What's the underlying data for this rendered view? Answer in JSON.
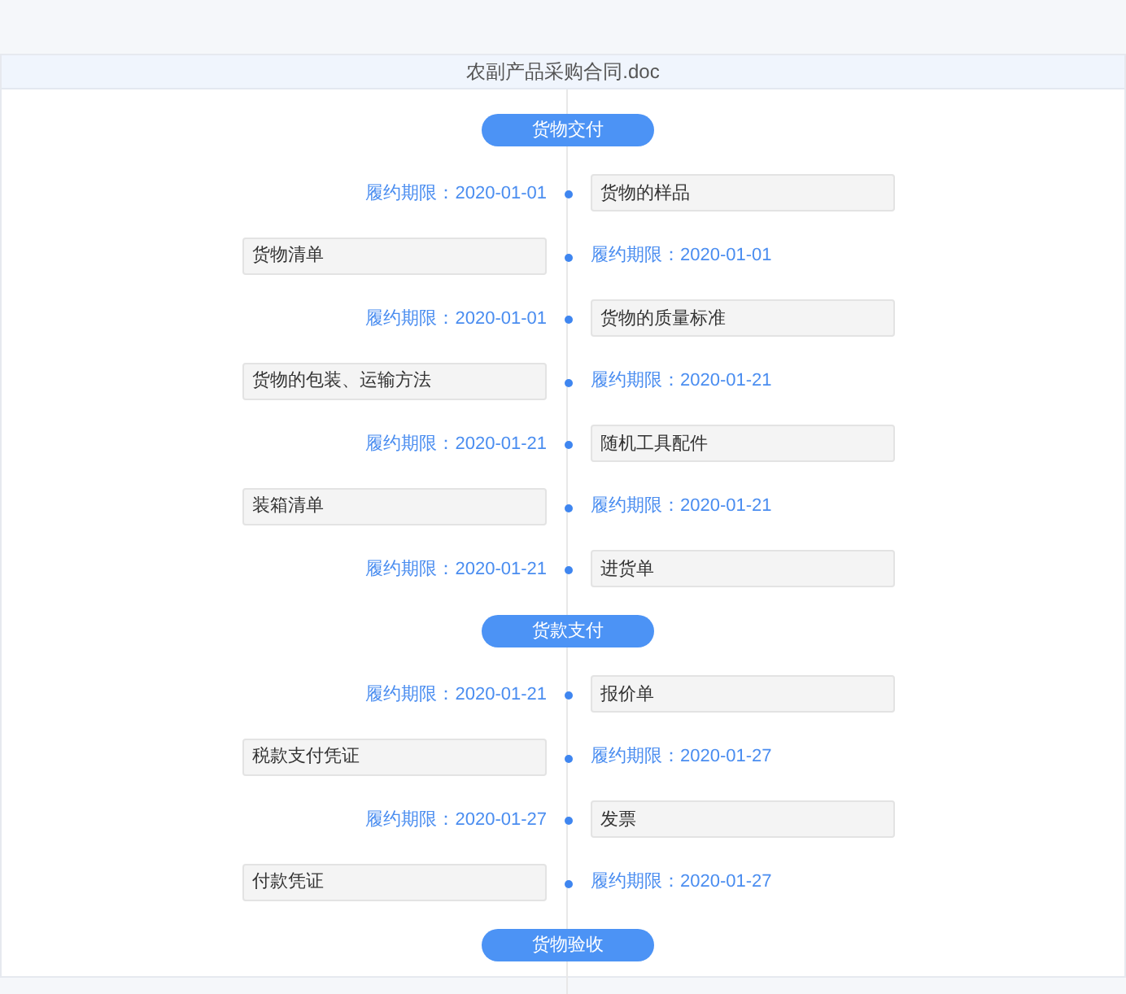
{
  "document": {
    "title": "农副产品采购合同.doc"
  },
  "phases": [
    {
      "title": "货物交付",
      "items": [
        {
          "name": "货物的样品",
          "deadline": "履约期限：2020-01-01",
          "kind": "right"
        },
        {
          "name": "货物清单",
          "deadline": "履约期限：2020-01-01",
          "kind": "left"
        },
        {
          "name": "货物的质量标准",
          "deadline": "履约期限：2020-01-01",
          "kind": "right"
        },
        {
          "name": "货物的包装、运输方法",
          "deadline": "履约期限：2020-01-21",
          "kind": "left"
        },
        {
          "name": "随机工具配件",
          "deadline": "履约期限：2020-01-21",
          "kind": "right"
        },
        {
          "name": "装箱清单",
          "deadline": "履约期限：2020-01-21",
          "kind": "left"
        },
        {
          "name": "进货单",
          "deadline": "履约期限：2020-01-21",
          "kind": "right"
        }
      ]
    },
    {
      "title": "货款支付",
      "items": [
        {
          "name": "报价单",
          "deadline": "履约期限：2020-01-21",
          "kind": "right"
        },
        {
          "name": "税款支付凭证",
          "deadline": "履约期限：2020-01-27",
          "kind": "left"
        },
        {
          "name": "发票",
          "deadline": "履约期限：2020-01-27",
          "kind": "right"
        },
        {
          "name": "付款凭证",
          "deadline": "履约期限：2020-01-27",
          "kind": "left"
        }
      ]
    },
    {
      "title": "货物验收"
    }
  ]
}
